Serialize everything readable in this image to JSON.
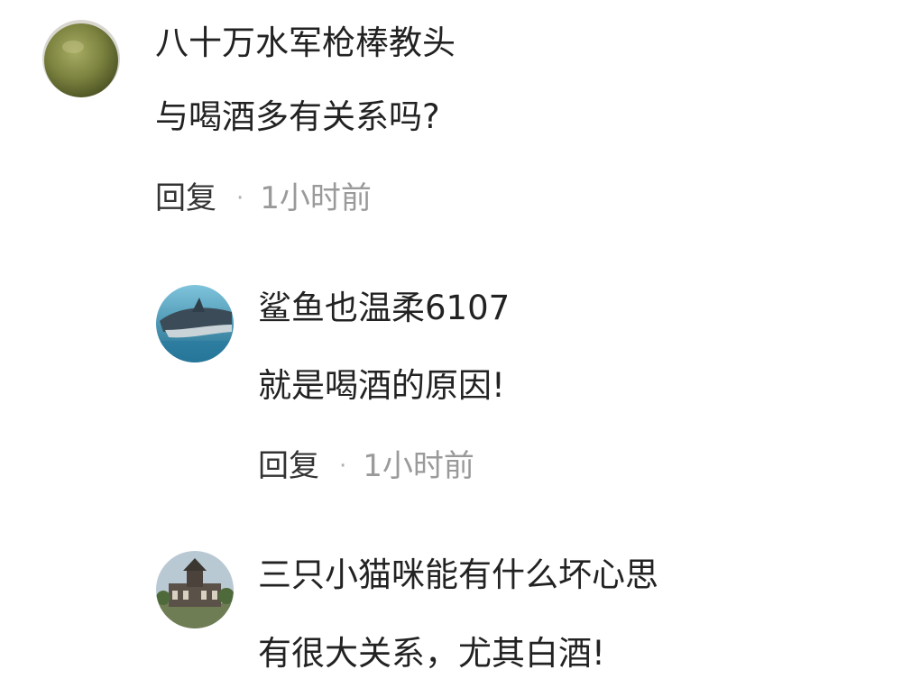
{
  "comments": [
    {
      "username": "八十万水军枪棒教头",
      "text": "与喝酒多有关系吗?",
      "reply_label": "回复",
      "separator": "·",
      "time": "1小时前",
      "avatar_icon": "green-ball-avatar"
    },
    {
      "username": "鲨鱼也温柔6107",
      "text": "就是喝酒的原因!",
      "reply_label": "回复",
      "separator": "·",
      "time": "1小时前",
      "avatar_icon": "shark-avatar"
    },
    {
      "username": "三只小猫咪能有什么坏心思",
      "text": "有很大关系，尤其白酒!",
      "avatar_icon": "building-avatar"
    }
  ],
  "colors": {
    "text_primary": "#222222",
    "time_gray": "#9a9a9a",
    "background": "#ffffff"
  }
}
